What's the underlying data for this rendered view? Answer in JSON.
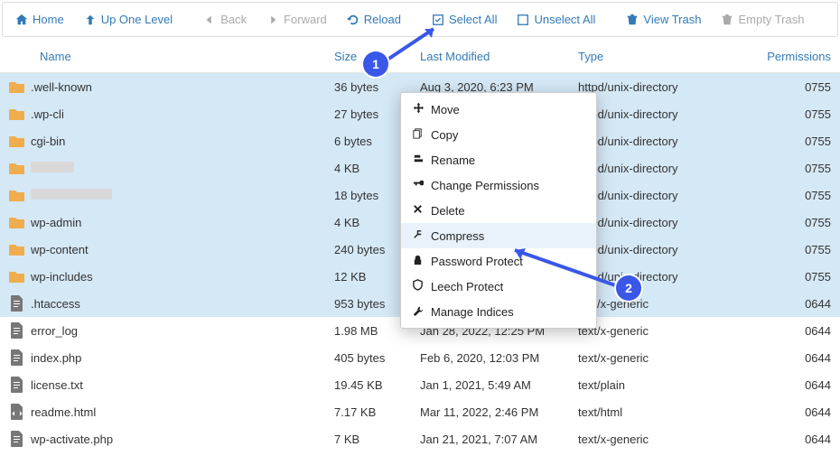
{
  "toolbar": {
    "home": "Home",
    "up": "Up One Level",
    "back": "Back",
    "forward": "Forward",
    "reload": "Reload",
    "select_all": "Select All",
    "unselect_all": "Unselect All",
    "view_trash": "View Trash",
    "empty_trash": "Empty Trash"
  },
  "columns": {
    "name": "Name",
    "size": "Size",
    "modified": "Last Modified",
    "type": "Type",
    "permissions": "Permissions"
  },
  "rows": [
    {
      "icon": "folder",
      "name": ".well-known",
      "size": "36 bytes",
      "modified": "Aug 3, 2020, 6:23 PM",
      "type": "httpd/unix-directory",
      "perm": "0755",
      "sel": true
    },
    {
      "icon": "folder",
      "name": ".wp-cli",
      "size": "27 bytes",
      "modified": "",
      "type": "httpd/unix-directory",
      "perm": "0755",
      "sel": true
    },
    {
      "icon": "folder",
      "name": "cgi-bin",
      "size": "6 bytes",
      "modified": "",
      "type": "httpd/unix-directory",
      "perm": "0755",
      "sel": true
    },
    {
      "icon": "folder",
      "name": "",
      "redact_w": 48,
      "size": "4 KB",
      "modified": "",
      "type": "httpd/unix-directory",
      "perm": "0755",
      "sel": true
    },
    {
      "icon": "folder",
      "name": "",
      "redact_w": 90,
      "size": "18 bytes",
      "modified": "",
      "type": "httpd/unix-directory",
      "perm": "0755",
      "sel": true
    },
    {
      "icon": "folder",
      "name": "wp-admin",
      "size": "4 KB",
      "modified": "",
      "type": "httpd/unix-directory",
      "perm": "0755",
      "sel": true
    },
    {
      "icon": "folder",
      "name": "wp-content",
      "size": "240 bytes",
      "modified": "",
      "type": "httpd/unix-directory",
      "perm": "0755",
      "sel": true
    },
    {
      "icon": "folder",
      "name": "wp-includes",
      "size": "12 KB",
      "modified": "",
      "type": "httpd/unix-directory",
      "perm": "0755",
      "sel": true
    },
    {
      "icon": "file",
      "name": ".htaccess",
      "size": "953 bytes",
      "modified": "",
      "type": "text/x-generic",
      "perm": "0644",
      "sel": true
    },
    {
      "icon": "file",
      "name": "error_log",
      "size": "1.98 MB",
      "modified": "Jan 28, 2022, 12:25 PM",
      "type": "text/x-generic",
      "perm": "0644",
      "sel": false
    },
    {
      "icon": "file",
      "name": "index.php",
      "size": "405 bytes",
      "modified": "Feb 6, 2020, 12:03 PM",
      "type": "text/x-generic",
      "perm": "0644",
      "sel": false
    },
    {
      "icon": "file",
      "name": "license.txt",
      "size": "19.45 KB",
      "modified": "Jan 1, 2021, 5:49 AM",
      "type": "text/plain",
      "perm": "0644",
      "sel": false
    },
    {
      "icon": "html",
      "name": "readme.html",
      "size": "7.17 KB",
      "modified": "Mar 11, 2022, 2:46 PM",
      "type": "text/html",
      "perm": "0644",
      "sel": false
    },
    {
      "icon": "file",
      "name": "wp-activate.php",
      "size": "7 KB",
      "modified": "Jan 21, 2021, 7:07 AM",
      "type": "text/x-generic",
      "perm": "0644",
      "sel": false
    }
  ],
  "context_menu": [
    {
      "icon": "move",
      "label": "Move"
    },
    {
      "icon": "copy",
      "label": "Copy"
    },
    {
      "icon": "rename",
      "label": "Rename"
    },
    {
      "icon": "perm",
      "label": "Change Permissions"
    },
    {
      "icon": "delete",
      "label": "Delete"
    },
    {
      "icon": "compress",
      "label": "Compress",
      "hover": true
    },
    {
      "icon": "lock",
      "label": "Password Protect"
    },
    {
      "icon": "shield",
      "label": "Leech Protect"
    },
    {
      "icon": "wrench",
      "label": "Manage Indices"
    }
  ],
  "badges": {
    "one": "1",
    "two": "2"
  }
}
